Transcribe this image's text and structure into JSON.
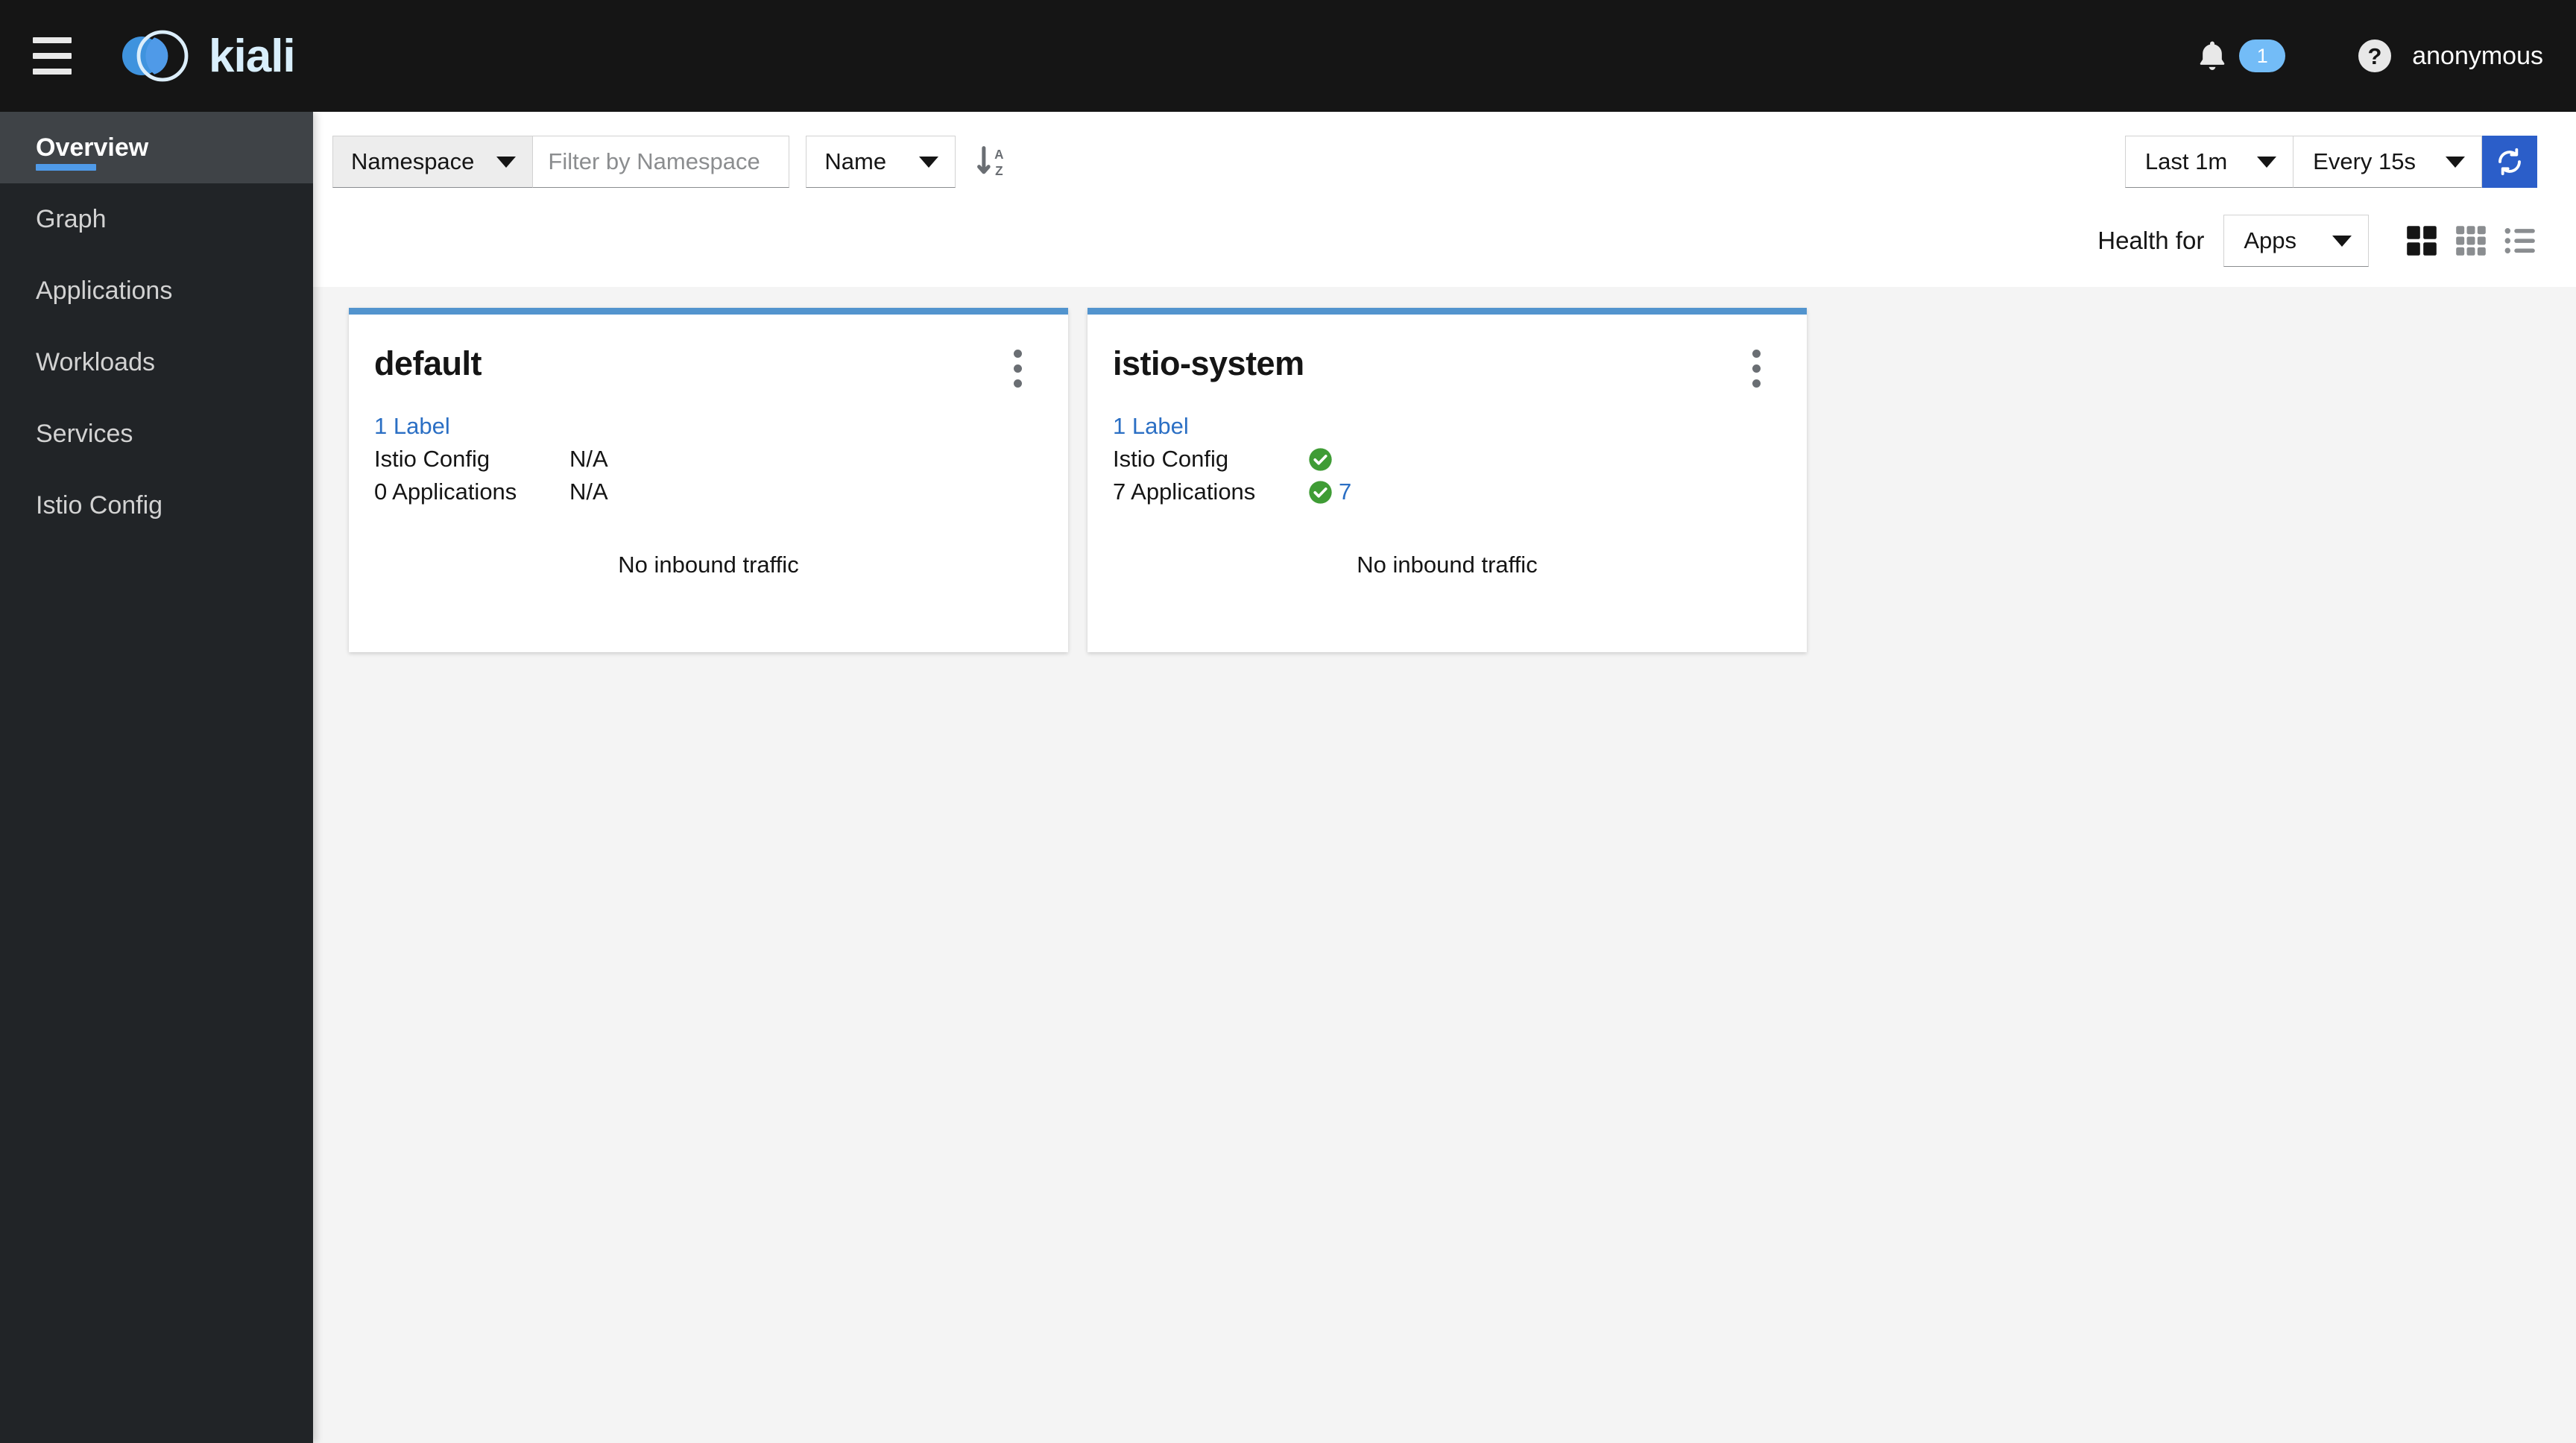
{
  "masthead": {
    "hamburger_name": "global-navigation-toggle",
    "brand_name": "kiali",
    "notification_count": "1",
    "username": "anonymous"
  },
  "sidebar": {
    "items": [
      {
        "label": "Overview",
        "active": true
      },
      {
        "label": "Graph",
        "active": false
      },
      {
        "label": "Applications",
        "active": false
      },
      {
        "label": "Workloads",
        "active": false
      },
      {
        "label": "Services",
        "active": false
      },
      {
        "label": "Istio Config",
        "active": false
      }
    ]
  },
  "toolbar": {
    "filter_type": "Namespace",
    "filter_placeholder": "Filter by Namespace",
    "sort_field": "Name",
    "sort_direction_icon": "sort-ascending-az-icon",
    "time_range": "Last 1m",
    "refresh_interval": "Every 15s",
    "refresh_button": "refresh-icon",
    "health_for_label": "Health for",
    "health_for_value": "Apps",
    "views": [
      {
        "name": "expand-view",
        "icon": "grid-2x2-icon",
        "active": true
      },
      {
        "name": "compact-view",
        "icon": "grid-3x3-icon",
        "active": false
      },
      {
        "name": "list-view",
        "icon": "list-icon",
        "active": false
      }
    ]
  },
  "cards": [
    {
      "name": "default",
      "labels_link": "1 Label",
      "istio_config_key": "Istio Config",
      "istio_config_value": "N/A",
      "istio_config_status": "none",
      "applications_key": "0 Applications",
      "applications_value": "N/A",
      "applications_status": "none",
      "applications_count": "",
      "traffic_text": "No inbound traffic"
    },
    {
      "name": "istio-system",
      "labels_link": "1 Label",
      "istio_config_key": "Istio Config",
      "istio_config_value": "",
      "istio_config_status": "healthy",
      "applications_key": "7 Applications",
      "applications_value": "",
      "applications_status": "healthy",
      "applications_count": "7",
      "traffic_text": "No inbound traffic"
    }
  ],
  "colors": {
    "masthead_bg": "#151515",
    "sidebar_bg": "#212427",
    "sidebar_active_bg": "#3f4347",
    "accent_blue": "#4f9ae8",
    "card_accent": "#5294ce",
    "link_blue": "#2b6fc4",
    "badge_blue": "#73bcf7",
    "refresh_blue": "#2b5ec9",
    "healthy_green": "#3f9c35",
    "content_bg": "#f4f4f4"
  }
}
